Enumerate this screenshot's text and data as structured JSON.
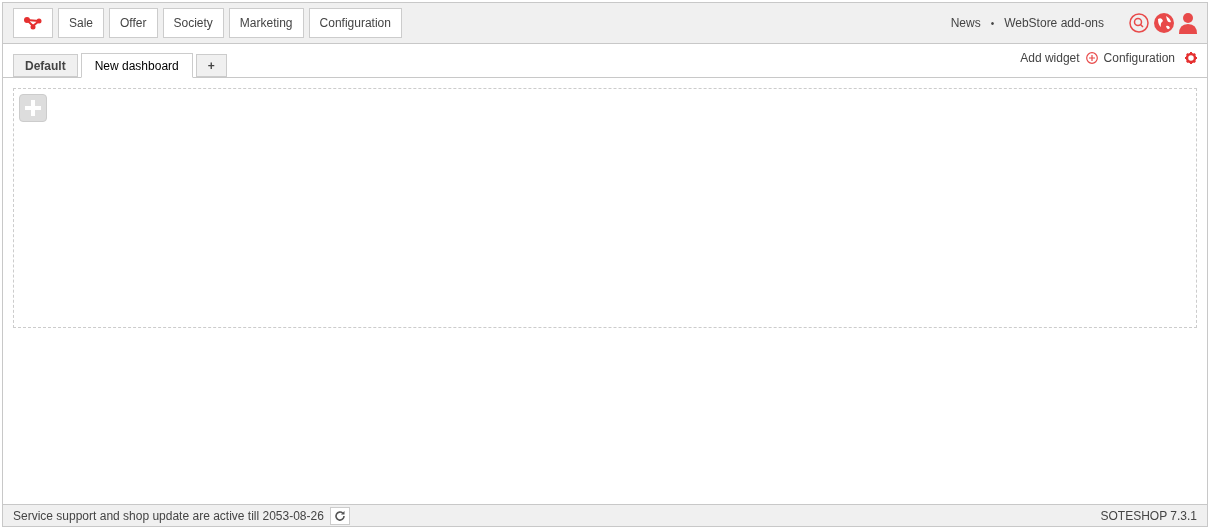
{
  "nav": {
    "items": [
      "Sale",
      "Offer",
      "Society",
      "Marketing",
      "Configuration"
    ]
  },
  "top_links": {
    "items": [
      "News",
      "WebStore add-ons"
    ],
    "separator": "•"
  },
  "tabs": [
    {
      "label": "Default",
      "selected": false
    },
    {
      "label": "New dashboard",
      "selected": true
    },
    {
      "label": "+",
      "selected": false
    }
  ],
  "actions": {
    "add_widget": "Add widget",
    "configuration": "Configuration"
  },
  "status_bar": {
    "left": "Service support and shop update are active till 2053-08-26",
    "right": "SOTESHOP 7.3.1"
  }
}
